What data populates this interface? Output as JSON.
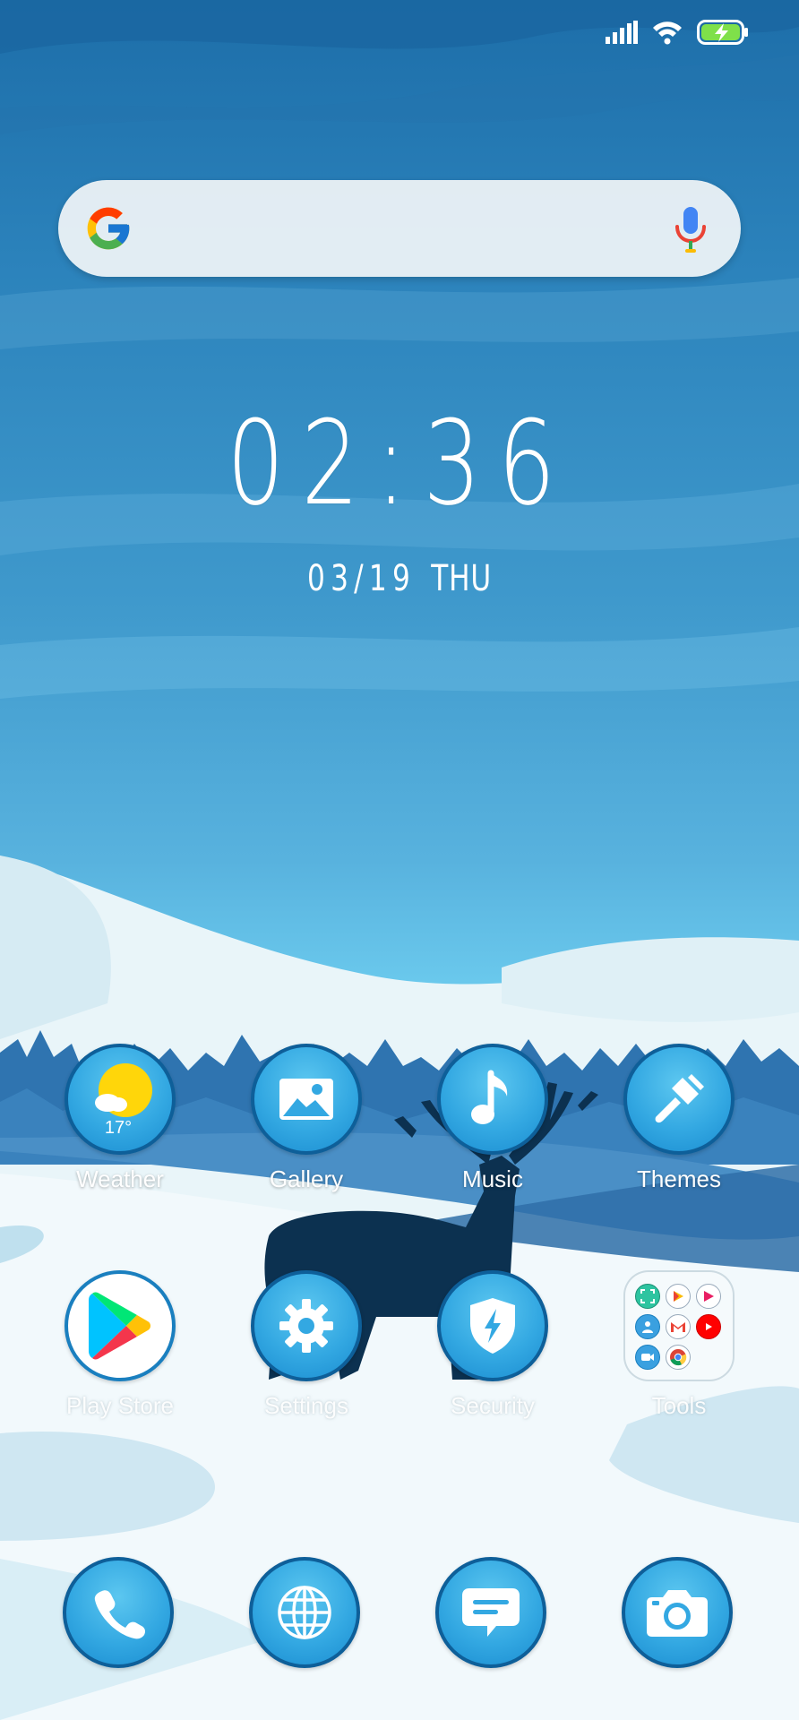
{
  "status_bar": {
    "signal_icon": "cell-signal-icon",
    "wifi_icon": "wifi-icon",
    "battery_icon": "battery-charging-icon"
  },
  "search": {
    "logo": "google-g-icon",
    "mic": "microphone-icon"
  },
  "clock": {
    "time": "02:36",
    "date": "03/19",
    "weekday": "THU"
  },
  "apps": [
    {
      "name": "weather",
      "label": "Weather",
      "icon": "weather-icon",
      "temperature": "17°"
    },
    {
      "name": "gallery",
      "label": "Gallery",
      "icon": "gallery-icon"
    },
    {
      "name": "music",
      "label": "Music",
      "icon": "music-note-icon"
    },
    {
      "name": "themes",
      "label": "Themes",
      "icon": "paint-brush-icon"
    },
    {
      "name": "play-store",
      "label": "Play Store",
      "icon": "play-store-icon"
    },
    {
      "name": "settings",
      "label": "Settings",
      "icon": "gear-icon"
    },
    {
      "name": "security",
      "label": "Security",
      "icon": "shield-bolt-icon"
    },
    {
      "name": "tools",
      "label": "Tools",
      "icon": "folder-icon"
    }
  ],
  "dock": [
    {
      "name": "phone",
      "icon": "phone-icon"
    },
    {
      "name": "browser",
      "icon": "globe-icon"
    },
    {
      "name": "messages",
      "icon": "message-icon"
    },
    {
      "name": "camera",
      "icon": "camera-icon"
    }
  ],
  "colors": {
    "sky_top": "#1d6ea9",
    "sky_bottom": "#7fd0ef",
    "icon_blue": "#33a8e2",
    "icon_border": "#0e5f99",
    "snow": "#f4fafc",
    "tree": "#2f74b0",
    "deer": "#0c3150"
  }
}
